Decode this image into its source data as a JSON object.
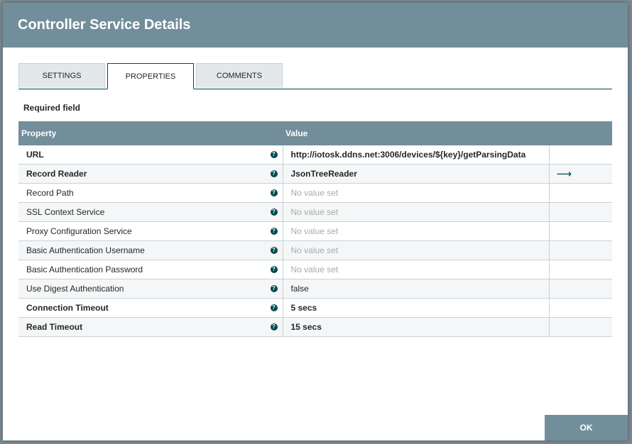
{
  "dialog": {
    "title": "Controller Service Details"
  },
  "tabs": [
    {
      "label": "SETTINGS",
      "active": false
    },
    {
      "label": "PROPERTIES",
      "active": true
    },
    {
      "label": "COMMENTS",
      "active": false
    }
  ],
  "required_label": "Required field",
  "table": {
    "headers": {
      "property": "Property",
      "value": "Value"
    },
    "rows": [
      {
        "name": "URL",
        "value": "http://iotosk.ddns.net:3006/devices/${key}/getParsingData",
        "required": true,
        "set": true,
        "goto": false
      },
      {
        "name": "Record Reader",
        "value": "JsonTreeReader",
        "required": true,
        "set": true,
        "goto": true
      },
      {
        "name": "Record Path",
        "value": "No value set",
        "required": false,
        "set": false,
        "goto": false
      },
      {
        "name": "SSL Context Service",
        "value": "No value set",
        "required": false,
        "set": false,
        "goto": false
      },
      {
        "name": "Proxy Configuration Service",
        "value": "No value set",
        "required": false,
        "set": false,
        "goto": false
      },
      {
        "name": "Basic Authentication Username",
        "value": "No value set",
        "required": false,
        "set": false,
        "goto": false
      },
      {
        "name": "Basic Authentication Password",
        "value": "No value set",
        "required": false,
        "set": false,
        "goto": false
      },
      {
        "name": "Use Digest Authentication",
        "value": "false",
        "required": false,
        "set": true,
        "goto": false
      },
      {
        "name": "Connection Timeout",
        "value": "5 secs",
        "required": true,
        "set": true,
        "goto": false
      },
      {
        "name": "Read Timeout",
        "value": "15 secs",
        "required": true,
        "set": true,
        "goto": false
      }
    ]
  },
  "icons": {
    "help": "?",
    "goto": "⟶"
  },
  "ok_label": "OK",
  "colors": {
    "header": "#728e9b",
    "accent": "#004849",
    "unset_text": "#aaaaaa"
  }
}
